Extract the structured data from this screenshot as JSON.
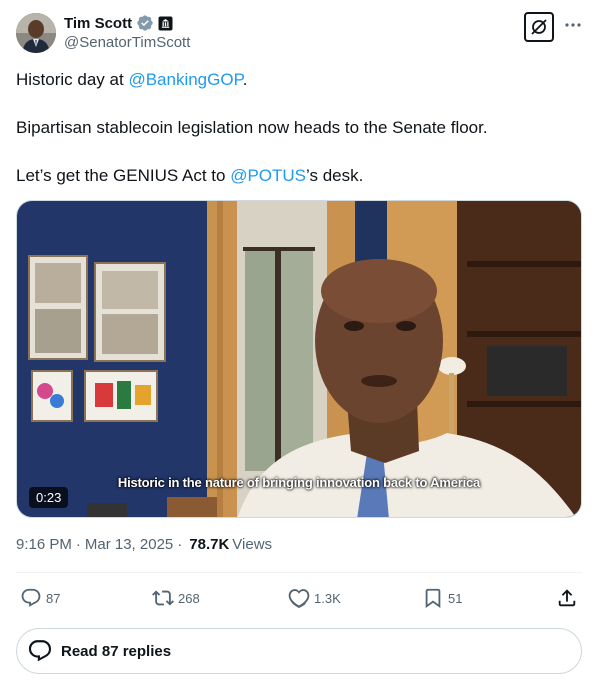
{
  "author": {
    "display_name": "Tim Scott",
    "handle": "@SenatorTimScott"
  },
  "tweet": {
    "line1_prefix": "Historic day at ",
    "line1_mention": "@BankingGOP",
    "line1_suffix": ".",
    "line2": "Bipartisan stablecoin legislation now heads to the Senate floor.",
    "line3_prefix": "Let’s get the GENIUS Act to ",
    "line3_mention": "@POTUS",
    "line3_suffix": "’s desk."
  },
  "video": {
    "caption": "Historic in the nature of bringing innovation back to America",
    "duration": "0:23"
  },
  "meta": {
    "time": "9:16 PM",
    "sep1": "·",
    "date": "Mar 13, 2025",
    "sep2": "·",
    "views_count": "78.7K",
    "views_label": "Views"
  },
  "actions": {
    "replies": "87",
    "reposts": "268",
    "likes": "1.3K",
    "bookmarks": "51"
  },
  "read_replies_label": "Read 87 replies",
  "icons": [
    "verified-badge-icon",
    "government-affiliation-icon",
    "grok-icon",
    "more-icon",
    "reply-icon",
    "repost-icon",
    "like-icon",
    "bookmark-icon",
    "share-icon",
    "replies-bubble-icon"
  ],
  "colors": {
    "accent": "#1d9bf0",
    "text": "#0f1419",
    "secondary": "#536471"
  }
}
